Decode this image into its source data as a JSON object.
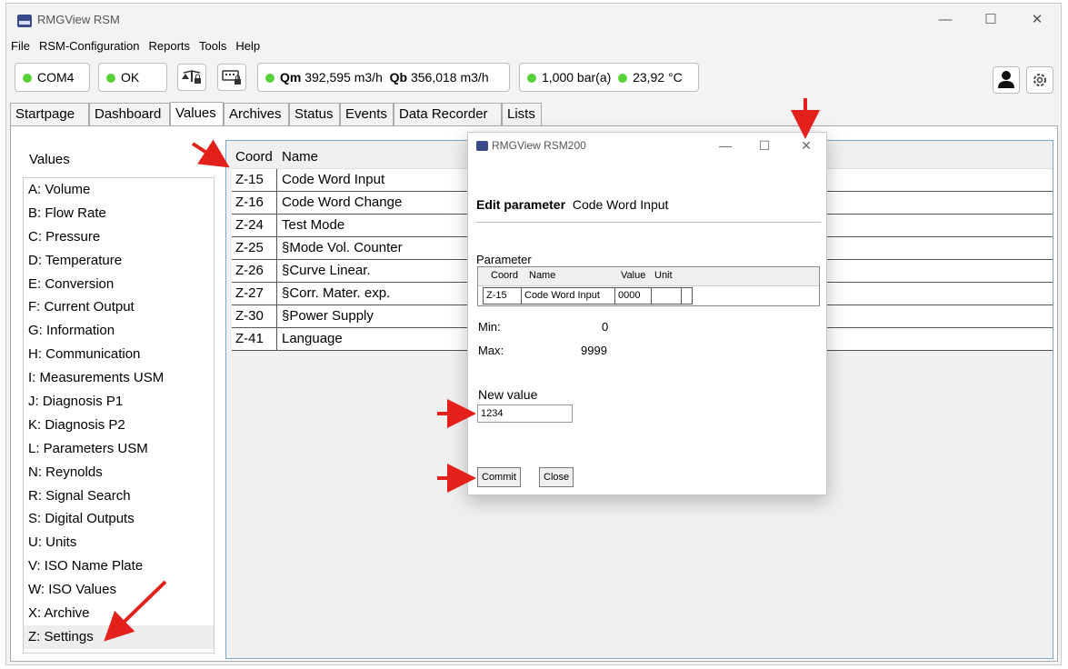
{
  "window": {
    "title": "RMGView RSM",
    "minimize": "—",
    "maximize": "☐",
    "close": "✕"
  },
  "menu": [
    "File",
    "RSM-Configuration",
    "Reports",
    "Tools",
    "Help"
  ],
  "toolbar": {
    "port": "COM4",
    "status": "OK",
    "qm_label": "Qm",
    "qm_value": "392,595 m3/h",
    "qb_label": "Qb",
    "qb_value": "356,018 m3/h",
    "pressure": "1,000  bar(a)",
    "temperature": "23,92 °C",
    "status_color": "#59d23a"
  },
  "tabs": [
    "Startpage",
    "Dashboard",
    "Values",
    "Archives",
    "Status",
    "Events",
    "Data Recorder",
    "Lists"
  ],
  "active_tab": "Values",
  "values": {
    "title": "Values",
    "items": [
      "A: Volume",
      "B: Flow Rate",
      "C: Pressure",
      "D: Temperature",
      "E: Conversion",
      "F: Current Output",
      "G: Information",
      "H: Communication",
      "I: Measurements USM",
      "J: Diagnosis P1",
      "K: Diagnosis P2",
      "L: Parameters USM",
      "N: Reynolds",
      "R: Signal Search",
      "S: Digital Outputs",
      "U: Units",
      "V: ISO Name Plate",
      "W: ISO Values",
      "X: Archive",
      "Z: Settings"
    ],
    "selected": "Z: Settings"
  },
  "table": {
    "headers": [
      "Coord",
      "Name"
    ],
    "rows": [
      [
        "Z-15",
        "Code Word Input"
      ],
      [
        "Z-16",
        "Code Word Change"
      ],
      [
        "Z-24",
        "Test Mode"
      ],
      [
        "Z-25",
        "§Mode Vol. Counter"
      ],
      [
        "Z-26",
        "§Curve Linear."
      ],
      [
        "Z-27",
        "§Corr. Mater. exp."
      ],
      [
        "Z-30",
        "§Power Supply"
      ],
      [
        "Z-41",
        "Language"
      ]
    ]
  },
  "dialog": {
    "title": "RMGView RSM200",
    "edit_label": "Edit parameter",
    "edit_name": "Code Word Input",
    "parameter_label": "Parameter",
    "param_headers": [
      "Coord",
      "Name",
      "Value",
      "Unit"
    ],
    "param_row": [
      "Z-15",
      "Code Word Input",
      "0000",
      ""
    ],
    "min_label": "Min:",
    "min_value": "0",
    "max_label": "Max:",
    "max_value": "9999",
    "new_value_label": "New value",
    "new_value": "1234",
    "commit": "Commit",
    "close": "Close"
  },
  "accent_arrow_color": "#e3201b"
}
